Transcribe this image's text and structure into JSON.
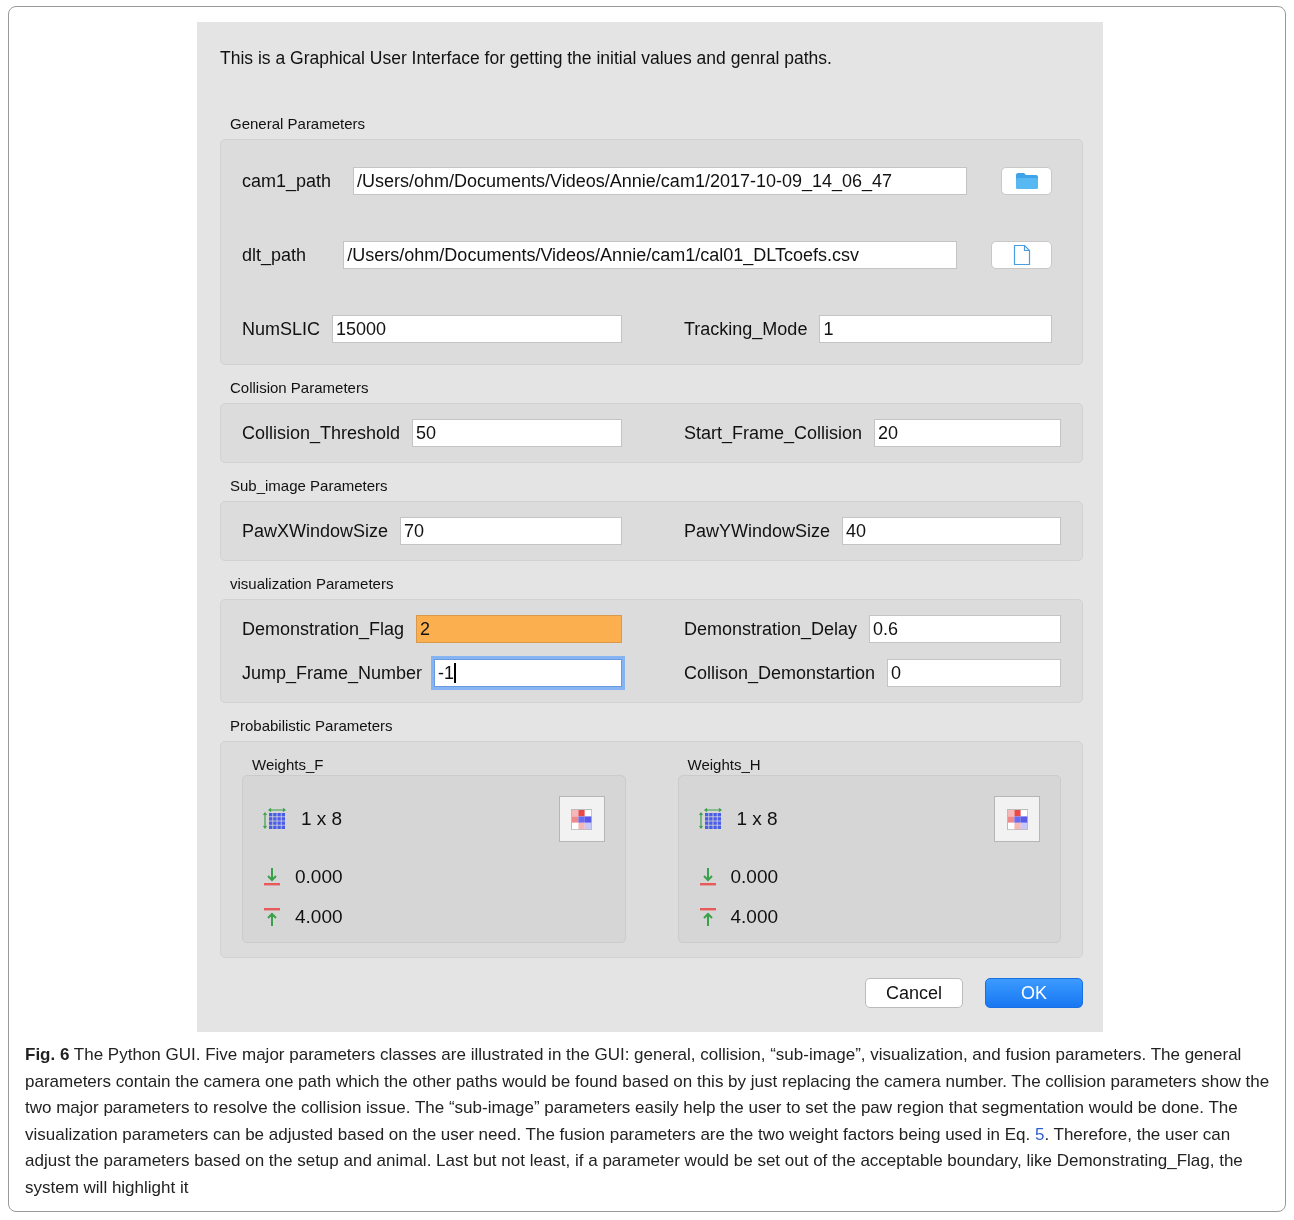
{
  "intro": "This is a Graphical User Interface for getting the initial values and genral paths.",
  "sections": [
    {
      "title": "General Parameters",
      "rows": [
        {
          "kind": "path",
          "label": "cam1_path",
          "value": "/Users/ohm/Documents/Videos/Annie/cam1/2017-10-09_14_06_47",
          "button": {
            "kind": "folder"
          }
        },
        {
          "kind": "path",
          "label": "dlt_path",
          "value": "/Users/ohm/Documents/Videos/Annie/cam1/cal01_DLTcoefs.csv",
          "button": {
            "kind": "file"
          }
        },
        {
          "kind": "pair",
          "fields": [
            {
              "label": "NumSLIC",
              "value": "15000",
              "highlighted": false,
              "focused": false
            },
            {
              "label": "Tracking_Mode",
              "value": "1",
              "highlighted": false,
              "focused": false
            }
          ]
        }
      ]
    },
    {
      "title": "Collision Parameters",
      "rows": [
        {
          "kind": "pair",
          "fields": [
            {
              "label": "Collision_Threshold",
              "value": "50",
              "highlighted": false,
              "focused": false
            },
            {
              "label": "Start_Frame_Collision",
              "value": "20",
              "highlighted": false,
              "focused": false
            }
          ]
        }
      ]
    },
    {
      "title": "Sub_image Parameters",
      "rows": [
        {
          "kind": "pair",
          "fields": [
            {
              "label": "PawXWindowSize",
              "value": "70",
              "highlighted": false,
              "focused": false
            },
            {
              "label": "PawYWindowSize",
              "value": "40",
              "highlighted": false,
              "focused": false
            }
          ]
        }
      ]
    },
    {
      "title": "visualization Parameters",
      "rows": [
        {
          "kind": "pair",
          "fields": [
            {
              "label": "Demonstration_Flag",
              "value": "2",
              "highlighted": true,
              "focused": false
            },
            {
              "label": "Demonstration_Delay",
              "value": "0.6",
              "highlighted": false,
              "focused": false
            }
          ]
        },
        {
          "kind": "pair",
          "fields": [
            {
              "label": "Jump_Frame_Number",
              "value": "-1",
              "highlighted": false,
              "focused": true
            },
            {
              "label": "Collison_Demonstartion",
              "value": "0",
              "highlighted": false,
              "focused": false
            }
          ]
        }
      ]
    },
    {
      "title": "Probabilistic Parameters",
      "rows": [
        {
          "kind": "matrices",
          "items": [
            {
              "title": "Weights_F",
              "size": "1 x 8",
              "min": "0.000",
              "max": "4.000"
            },
            {
              "title": "Weights_H",
              "size": "1 x 8",
              "min": "0.000",
              "max": "4.000"
            }
          ]
        }
      ]
    }
  ],
  "buttons": [
    {
      "label": "Cancel",
      "default": false
    },
    {
      "label": "OK",
      "default": true
    }
  ],
  "caption": {
    "label": "Fig. 6",
    "before": " The Python GUI. Five major parameters classes are illustrated in the GUI: general, collision, “sub-image”, visualization, and fusion parameters. The general parameters contain the camera one path which the other paths would be found based on this by just replacing the camera number. The collision parameters show the two major parameters to resolve the collision issue. The “sub-image” parameters easily help the user to set the paw region that segmentation would be done. The visualization parameters can be adjusted based on the user need. The fusion parameters are the two weight factors being used in Eq. ",
    "link": "5",
    "after": ". Therefore, the user can adjust the parameters based on the setup and animal. Last but not least, if a parameter would be set out of the acceptable boundary, like Demonstrating_Flag, the system will highlight it"
  }
}
